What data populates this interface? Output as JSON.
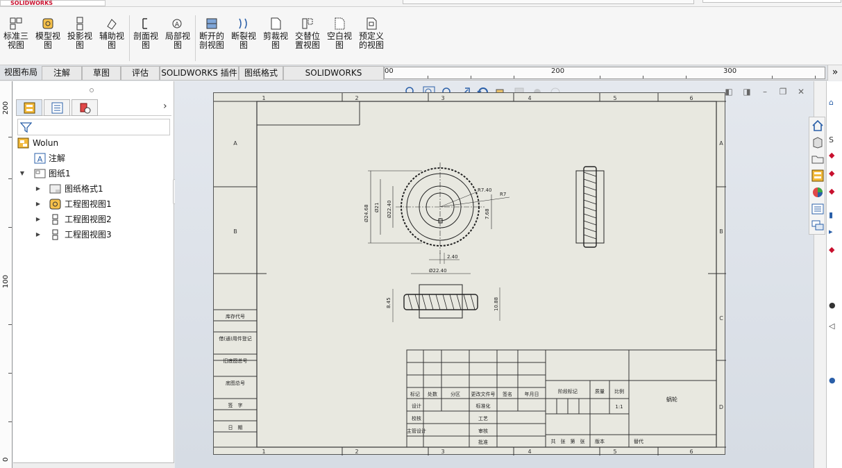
{
  "app": {
    "logo_text": "SOLIDWORKS"
  },
  "ribbon": {
    "buttons": [
      {
        "label_l1": "标准三",
        "label_l2": "视图",
        "icon": "standard-3-view-icon"
      },
      {
        "label_l1": "模型视",
        "label_l2": "图",
        "icon": "model-view-icon"
      },
      {
        "label_l1": "投影视",
        "label_l2": "图",
        "icon": "projected-view-icon"
      },
      {
        "label_l1": "辅助视",
        "label_l2": "图",
        "icon": "auxiliary-view-icon"
      },
      {
        "label_l1": "剖面视",
        "label_l2": "图",
        "icon": "section-view-icon"
      },
      {
        "label_l1": "局部视",
        "label_l2": "图",
        "icon": "detail-view-icon"
      },
      {
        "label_l1": "断开的",
        "label_l2": "剖视图",
        "icon": "broken-out-section-icon"
      },
      {
        "label_l1": "断裂视",
        "label_l2": "图",
        "icon": "break-view-icon"
      },
      {
        "label_l1": "剪裁视",
        "label_l2": "图",
        "icon": "crop-view-icon"
      },
      {
        "label_l1": "交替位",
        "label_l2": "置视图",
        "icon": "alternate-position-view-icon"
      },
      {
        "label_l1": "空白视",
        "label_l2": "图",
        "icon": "empty-view-icon"
      },
      {
        "label_l1": "预定义",
        "label_l2": "的视图",
        "icon": "predefined-view-icon"
      }
    ]
  },
  "tabs": [
    "视图布局",
    "注解",
    "草图",
    "评估",
    "SOLIDWORKS 插件",
    "图纸格式",
    "SOLIDWORKS Inspection"
  ],
  "hruler_labels": [
    "200",
    "300"
  ],
  "vruler_labels": [
    "200",
    "100",
    "0"
  ],
  "tree": {
    "root": "Wolun",
    "items": [
      {
        "label": "注解",
        "icon": "annotations-icon",
        "level": 1,
        "expander": ""
      },
      {
        "label": "图纸1",
        "icon": "sheet-icon",
        "level": 1,
        "expander": "▼"
      },
      {
        "label": "图纸格式1",
        "icon": "sheet-format-icon",
        "level": 2,
        "expander": "▶"
      },
      {
        "label": "工程图视图1",
        "icon": "drawing-view-icon",
        "level": 2,
        "expander": "▶"
      },
      {
        "label": "工程图视图2",
        "icon": "drawing-view-icon",
        "level": 2,
        "expander": "▶"
      },
      {
        "label": "工程图视图3",
        "icon": "drawing-view-icon",
        "level": 2,
        "expander": "▶"
      }
    ]
  },
  "sheet": {
    "zone_cols": [
      "1",
      "2",
      "3",
      "4",
      "5",
      "6"
    ],
    "zone_rows": [
      "A",
      "B",
      "C",
      "D"
    ],
    "dims": {
      "d1": "Ø24.68",
      "d2": "Ø21",
      "d3": "Ø22.40",
      "r1": "R7.40",
      "r2": "R7",
      "w1": "7.68",
      "h1": "2.40",
      "top": "Ø22.40",
      "left": "8.45",
      "right": "10.88"
    },
    "left_column": [
      "库存代号",
      "借(通)用件登记",
      "旧底图总号",
      "底图总号",
      "签　字",
      "日　期"
    ],
    "title_block": {
      "headers": [
        "标记",
        "处数",
        "分区",
        "更改文件号",
        "签名",
        "年月日"
      ],
      "roles": [
        "设计",
        "校核",
        "主管设计"
      ],
      "roles2": [
        "标准化",
        "工艺",
        "审核",
        "批准"
      ],
      "stage": "阶段标记",
      "weight": "质量",
      "scale": "比例",
      "scale_value": "1:1",
      "part_name": "蜗轮",
      "sheets": "共　张　第　张",
      "version": "版本",
      "replace": "替代"
    }
  }
}
